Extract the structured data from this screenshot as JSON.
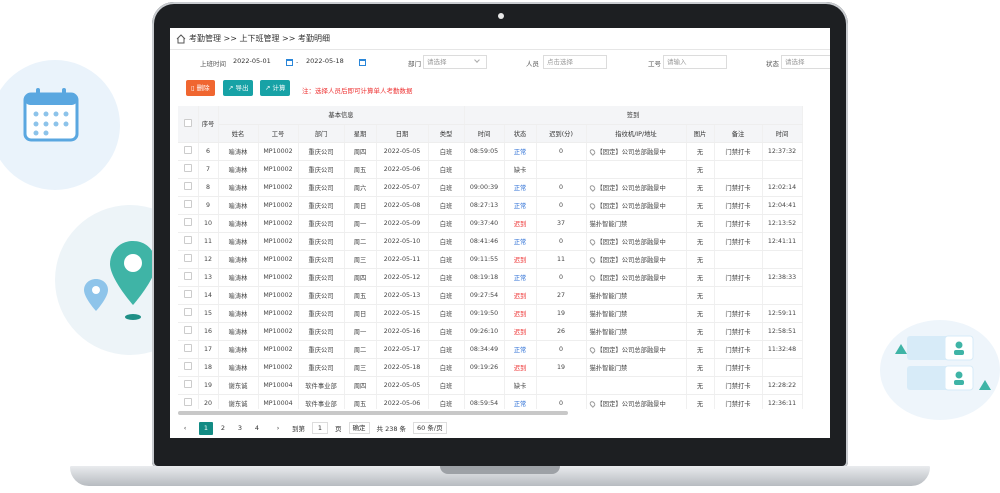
{
  "breadcrumb": "考勤管理 >> 上下班管理 >> 考勤明细",
  "filters": {
    "date_label": "上班时间",
    "date_from": "2022-05-01",
    "dash": "-",
    "date_to": "2022-05-18",
    "dept_label": "部门",
    "dept_placeholder": "请选择",
    "person_label": "人员",
    "person_placeholder": "点击选择",
    "id_label": "工号",
    "id_placeholder": "请输入",
    "status_label": "状态",
    "status_placeholder": "请选择"
  },
  "toolbar": {
    "delete": "删除",
    "export": "导出",
    "calc": "计算",
    "note": "注：选择人员后即可计算单人考勤数据"
  },
  "table": {
    "group_basic": "基本信息",
    "group_sign": "签到",
    "col_index": "序号",
    "columns": [
      "姓名",
      "工号",
      "部门",
      "星期",
      "日期",
      "类型",
      "时间",
      "状态",
      "迟到(分)",
      "指纹机/IP/地址",
      "图片",
      "备注",
      "时间"
    ],
    "rows": [
      [
        "6",
        "喻涛林",
        "MP10002",
        "重庆公司",
        "周四",
        "2022-05-05",
        "白班",
        "08:59:05",
        "正常",
        "0",
        "【固定】公司总部融景中",
        "无",
        "门禁打卡",
        "12:37:32"
      ],
      [
        "7",
        "喻涛林",
        "MP10002",
        "重庆公司",
        "周五",
        "2022-05-06",
        "白班",
        "",
        "缺卡",
        "",
        "",
        "无",
        "",
        ""
      ],
      [
        "8",
        "喻涛林",
        "MP10002",
        "重庆公司",
        "周六",
        "2022-05-07",
        "白班",
        "09:00:39",
        "正常",
        "0",
        "【固定】公司总部融景中",
        "无",
        "门禁打卡",
        "12:02:14"
      ],
      [
        "9",
        "喻涛林",
        "MP10002",
        "重庆公司",
        "周日",
        "2022-05-08",
        "白班",
        "08:27:13",
        "正常",
        "0",
        "【固定】公司总部融景中",
        "无",
        "门禁打卡",
        "12:04:41"
      ],
      [
        "10",
        "喻涛林",
        "MP10002",
        "重庆公司",
        "周一",
        "2022-05-09",
        "白班",
        "09:37:40",
        "迟到",
        "37",
        "猫扑智能门禁",
        "无",
        "门禁打卡",
        "12:13:52"
      ],
      [
        "11",
        "喻涛林",
        "MP10002",
        "重庆公司",
        "周二",
        "2022-05-10",
        "白班",
        "08:41:46",
        "正常",
        "0",
        "【固定】公司总部融景中",
        "无",
        "门禁打卡",
        "12:41:11"
      ],
      [
        "12",
        "喻涛林",
        "MP10002",
        "重庆公司",
        "周三",
        "2022-05-11",
        "白班",
        "09:11:55",
        "迟到",
        "11",
        "【固定】公司总部融景中",
        "无",
        "",
        ""
      ],
      [
        "13",
        "喻涛林",
        "MP10002",
        "重庆公司",
        "周四",
        "2022-05-12",
        "白班",
        "08:19:18",
        "正常",
        "0",
        "【固定】公司总部融景中",
        "无",
        "门禁打卡",
        "12:38:33"
      ],
      [
        "14",
        "喻涛林",
        "MP10002",
        "重庆公司",
        "周五",
        "2022-05-13",
        "白班",
        "09:27:54",
        "迟到",
        "27",
        "猫扑智能门禁",
        "无",
        "",
        ""
      ],
      [
        "15",
        "喻涛林",
        "MP10002",
        "重庆公司",
        "周日",
        "2022-05-15",
        "白班",
        "09:19:50",
        "迟到",
        "19",
        "猫扑智能门禁",
        "无",
        "门禁打卡",
        "12:59:11"
      ],
      [
        "16",
        "喻涛林",
        "MP10002",
        "重庆公司",
        "周一",
        "2022-05-16",
        "白班",
        "09:26:10",
        "迟到",
        "26",
        "猫扑智能门禁",
        "无",
        "门禁打卡",
        "12:58:51"
      ],
      [
        "17",
        "喻涛林",
        "MP10002",
        "重庆公司",
        "周二",
        "2022-05-17",
        "白班",
        "08:34:49",
        "正常",
        "0",
        "【固定】公司总部融景中",
        "无",
        "门禁打卡",
        "11:32:48"
      ],
      [
        "18",
        "喻涛林",
        "MP10002",
        "重庆公司",
        "周三",
        "2022-05-18",
        "白班",
        "09:19:26",
        "迟到",
        "19",
        "猫扑智能门禁",
        "无",
        "门禁打卡",
        ""
      ],
      [
        "19",
        "谢东诚",
        "MP10004",
        "软件事业部",
        "周四",
        "2022-05-05",
        "白班",
        "",
        "缺卡",
        "",
        "",
        "无",
        "门禁打卡",
        "12:28:22"
      ],
      [
        "20",
        "谢东诚",
        "MP10004",
        "软件事业部",
        "周五",
        "2022-05-06",
        "白班",
        "08:59:54",
        "正常",
        "0",
        "【固定】公司总部融景中",
        "无",
        "门禁打卡",
        "12:36:11"
      ],
      [
        "",
        "",
        "",
        "",
        "",
        "",
        "",
        "",
        "",
        "",
        "【固定】公司总部融景中",
        "",
        "",
        ""
      ]
    ]
  },
  "pager": {
    "pages": [
      "1",
      "2",
      "3",
      "4"
    ],
    "goto": "到第",
    "goto_value": "1",
    "page_unit": "页",
    "confirm": "确定",
    "total": "共 238 条",
    "page_size": "60 条/页"
  }
}
